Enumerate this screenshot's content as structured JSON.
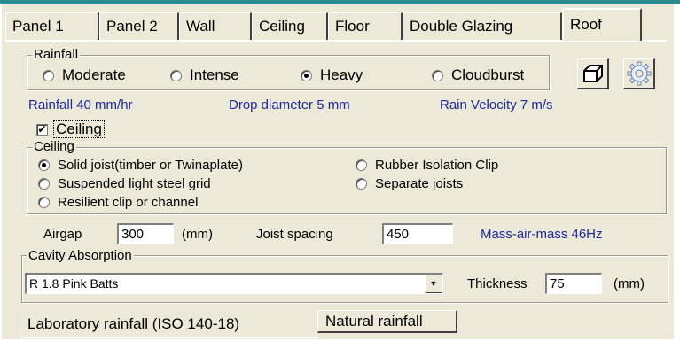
{
  "tabs": [
    "Panel 1",
    "Panel 2",
    "Wall",
    "Ceiling",
    "Floor",
    "Double Glazing",
    "Roof"
  ],
  "rainfall": {
    "legend": "Rainfall",
    "options": [
      "Moderate",
      "Intense",
      "Heavy",
      "Cloudburst"
    ],
    "selected": "Heavy",
    "info": {
      "rate": "Rainfall 40 mm/hr",
      "drop": "Drop diameter 5 mm",
      "velocity": "Rain Velocity 7 m/s"
    }
  },
  "ceiling_checkbox": {
    "label": "Ceiling",
    "checked": true,
    "mark": "✔"
  },
  "ceiling_group": {
    "legend": "Ceiling",
    "options": [
      "Solid joist(timber or Twinaplate)",
      "Suspended light steel grid",
      "Resilient clip or channel",
      "Rubber Isolation Clip",
      "Separate joists"
    ],
    "selected": "Solid joist(timber or Twinaplate)"
  },
  "airgap": {
    "label": "Airgap",
    "value": "300",
    "unit": "(mm)"
  },
  "joist_spacing": {
    "label": "Joist spacing",
    "value": "450"
  },
  "mass_air_mass": "Mass-air-mass 46Hz",
  "cavity": {
    "legend": "Cavity Absorption",
    "selected": "R 1.8 Pink Batts",
    "thickness_label": "Thickness",
    "thickness_value": "75",
    "thickness_unit": "(mm)"
  },
  "bottom_tabs": [
    "Laboratory rainfall (ISO 140-18)",
    "Natural rainfall"
  ],
  "active_bottom_tab": "Laboratory rainfall (ISO 140-18)",
  "colors": {
    "info_blue": "#1f2a9a",
    "panel": "#ece9d8",
    "top_strip": "#2e8b8b"
  },
  "icons": [
    "box-3d-icon",
    "settings-gear-icon",
    "dropdown-arrow-icon",
    "checkmark-icon"
  ]
}
